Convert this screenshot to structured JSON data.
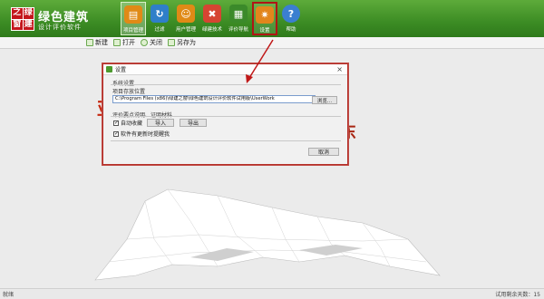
{
  "app": {
    "logo_chars": [
      "之",
      "绿",
      "窗",
      "建"
    ],
    "title": "绿色建筑",
    "subtitle": "设计评价软件"
  },
  "ribbon": [
    {
      "label": "项目管理",
      "icon": "folder-icon",
      "color": "#e08a16",
      "glyph": "▤"
    },
    {
      "label": "过滤",
      "icon": "refresh-icon",
      "color": "#2f7fc9",
      "glyph": "↻"
    },
    {
      "label": "用户管理",
      "icon": "user-icon",
      "color": "#e08a16",
      "glyph": "☺"
    },
    {
      "label": "绿建技术",
      "icon": "tech-icon",
      "color": "#d64532",
      "glyph": "✖"
    },
    {
      "label": "评价导航",
      "icon": "navigation-icon",
      "color": "#3b8a2a",
      "glyph": "▦"
    },
    {
      "label": "设置",
      "icon": "gear-icon",
      "color": "#e2861c",
      "glyph": "✷"
    },
    {
      "label": "帮助",
      "icon": "help-icon",
      "color": "#3b7fd0",
      "glyph": "?"
    }
  ],
  "toolbar": {
    "new": "新建",
    "open": "打开",
    "close": "关闭",
    "save_as": "另存为"
  },
  "workspace": {
    "bg_char_left": "亚",
    "bg_char_right": "东"
  },
  "dialog": {
    "title": "设置",
    "close_glyph": "×",
    "system_group": "系统设置",
    "project_location_label": "项目存放位置",
    "project_path": "C:\\Program Files (x86)\\绿建之窗\\绿色建筑设计评价软件试用版\\UserWork",
    "browse": "浏览...",
    "eval_group": "评价要点说明、证明材料",
    "auto_collect": "自动收藏",
    "auto_collect_checked": true,
    "import": "导入",
    "export": "导出",
    "update_notify": "软件有更新时提醒我",
    "update_notify_checked": true,
    "cancel": "取消"
  },
  "status": {
    "left": "就绪",
    "right": "试用剩余天数：15"
  },
  "colors": {
    "banner": "#3c8c24",
    "highlight": "#b01515"
  }
}
